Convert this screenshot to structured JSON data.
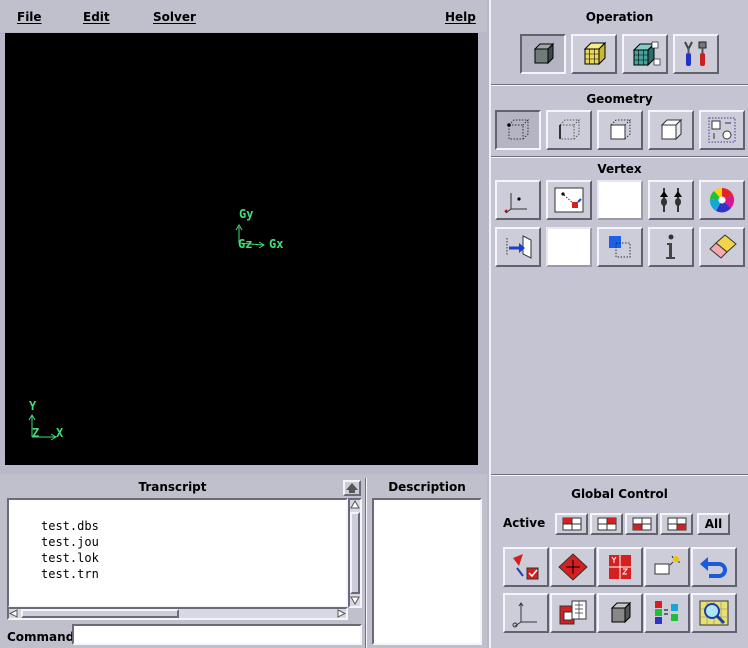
{
  "menu": {
    "file": "File",
    "edit": "Edit",
    "solver": "Solver",
    "help": "Help"
  },
  "viewport": {
    "origin_labels": {
      "gy": "Gy",
      "gz": "Gz",
      "gx": "Gx"
    },
    "corner_labels": {
      "y": "Y",
      "z": "Z",
      "x": "X"
    }
  },
  "operation": {
    "title": "Operation",
    "buttons": [
      "geometry-cube-icon",
      "mesh-cube-icon",
      "zones-cube-icon",
      "tools-icon"
    ]
  },
  "geometry": {
    "title": "Geometry",
    "buttons": [
      "vertex-cube-icon",
      "edge-cube-icon",
      "face-cube-icon",
      "volume-cube-icon",
      "group-icon"
    ]
  },
  "vertex": {
    "title": "Vertex",
    "buttons": [
      "create-vertex-icon",
      "move-vertex-icon",
      "empty",
      "connect-vertex-icon",
      "color-wheel-icon",
      "project-vertex-icon",
      "empty",
      "select-vertex-icon",
      "info-icon",
      "eraser-icon"
    ]
  },
  "transcript": {
    "title": "Transcript",
    "lines": [
      "test.dbs",
      "test.jou",
      "test.lok",
      "test.trn"
    ]
  },
  "description": {
    "title": "Description"
  },
  "command": {
    "label": "Command:",
    "value": ""
  },
  "global_control": {
    "title": "Global Control",
    "active_label": "Active",
    "all_label": "All"
  },
  "colors": {
    "viewport_bg": "#000000",
    "axis_green": "#3ee07a",
    "panel_bg": "#c4c4d2"
  }
}
